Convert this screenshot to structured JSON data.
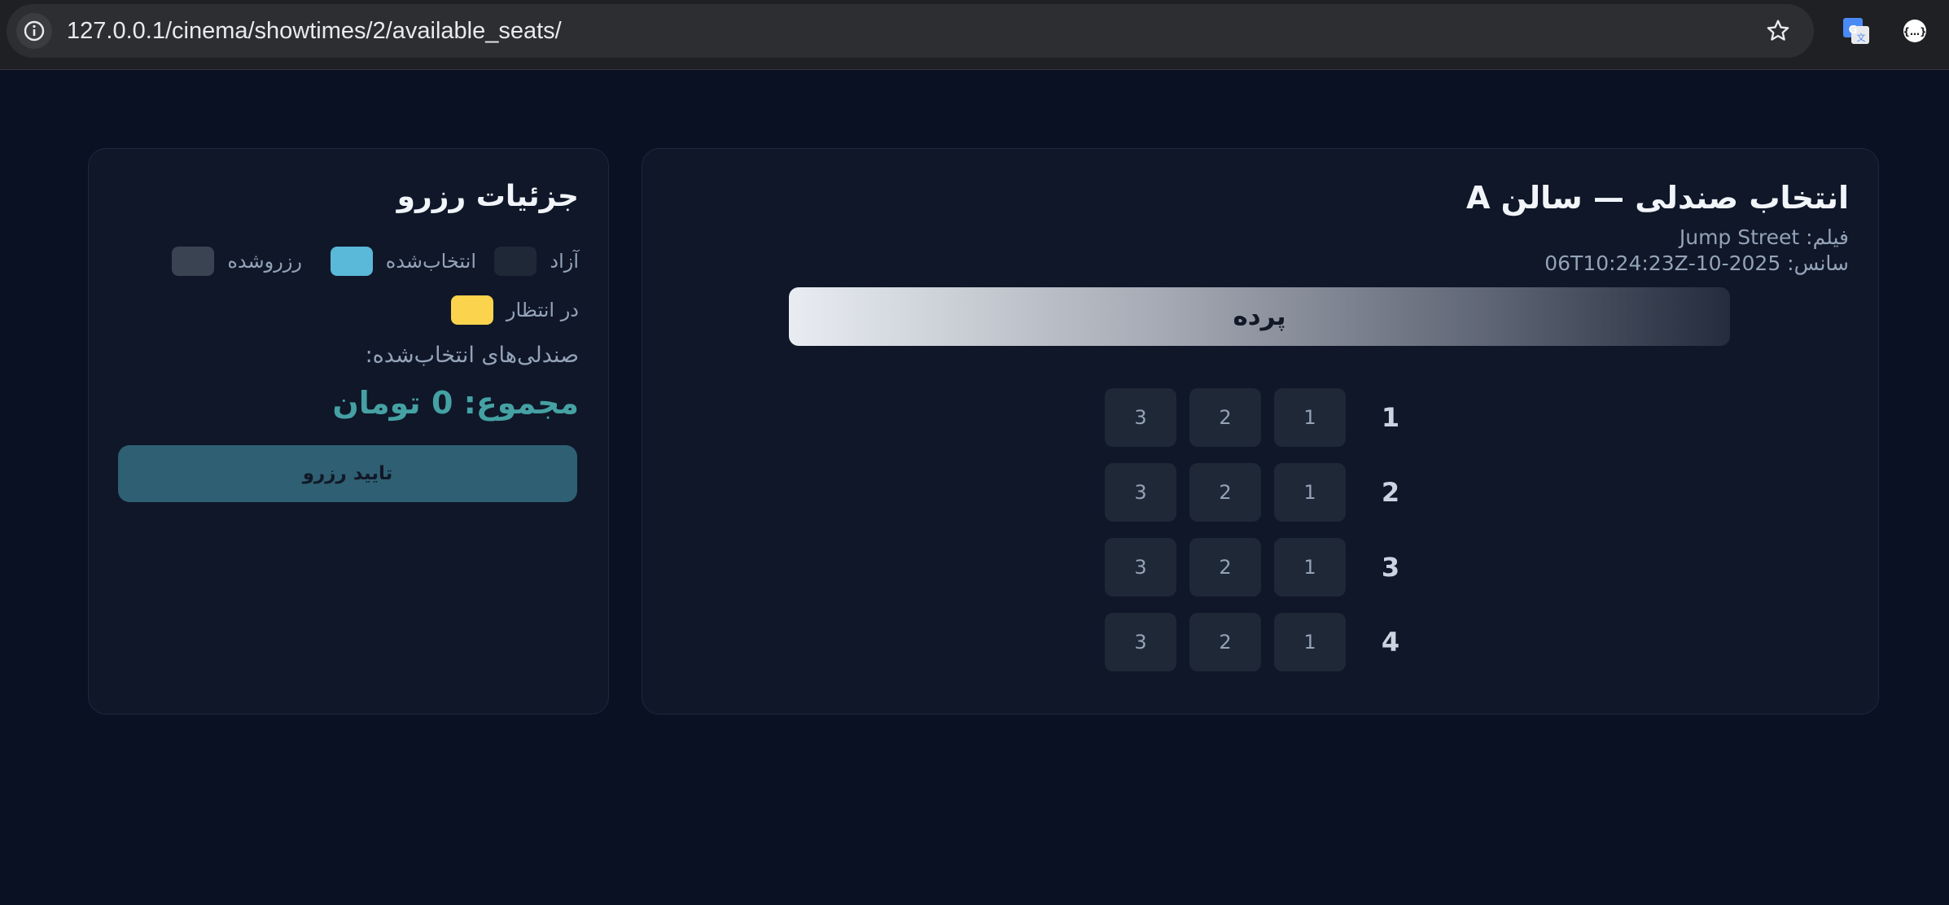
{
  "browser": {
    "url": "127.0.0.1/cinema/showtimes/2/available_seats/",
    "info_icon": "info-icon",
    "bookmark_icon": "star-icon",
    "extensions": [
      "google-translate-icon",
      "extension-icon"
    ]
  },
  "seat_selection": {
    "title": "انتخاب صندلی — سالن A",
    "movie_line": "فیلم: Jump Street",
    "showtime_line": "سانس: 2025-10-06T10:24:23Z",
    "screen_label": "پرده",
    "rows": [
      {
        "label": "1",
        "seats": [
          "1",
          "2",
          "3"
        ]
      },
      {
        "label": "2",
        "seats": [
          "1",
          "2",
          "3"
        ]
      },
      {
        "label": "3",
        "seats": [
          "1",
          "2",
          "3"
        ]
      },
      {
        "label": "4",
        "seats": [
          "1",
          "2",
          "3"
        ]
      }
    ],
    "seat_status": "free"
  },
  "booking_details": {
    "title": "جزئیات رزرو",
    "legend": {
      "free": {
        "label": "آزاد",
        "color": "#1f2836"
      },
      "selected": {
        "label": "انتخاب‌شده",
        "color": "#5ab8d9"
      },
      "reserved": {
        "label": "رزروشده",
        "color": "#3a4352"
      },
      "pending": {
        "label": "در انتظار",
        "color": "#fcd34d"
      }
    },
    "selected_seats_label": "صندلی‌های انتخاب‌شده:",
    "total_label": "مجموع: 0 تومان",
    "confirm_label": "تایید رزرو"
  },
  "colors": {
    "background": "#0a1122",
    "panel": "#0f1729",
    "accent": "#45a1a3",
    "button": "#2f5f72"
  }
}
